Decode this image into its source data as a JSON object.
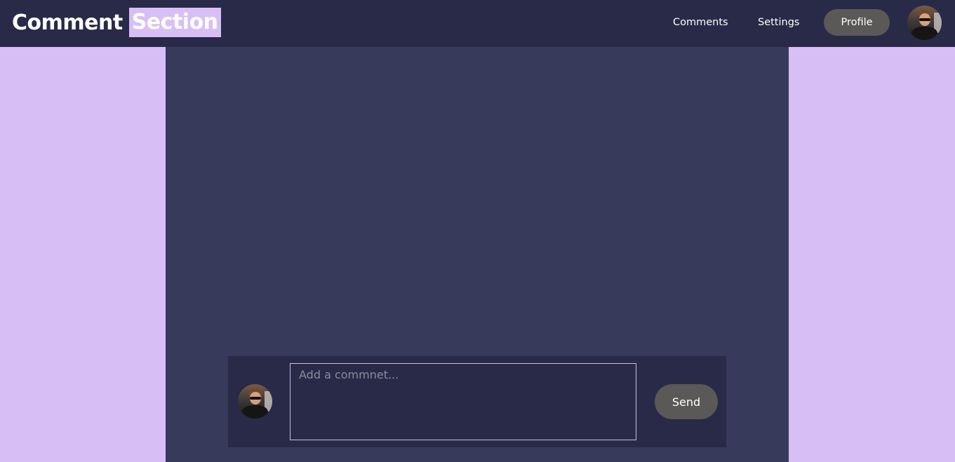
{
  "header": {
    "brand_word1": "Comment",
    "brand_word2": "Section",
    "nav_links": [
      "Comments",
      "Settings"
    ],
    "profile_label": "Profile"
  },
  "composer": {
    "placeholder": "Add a commnet...",
    "value": "",
    "send_label": "Send"
  },
  "colors": {
    "page_background": "#d7bff5",
    "navbar": "#292a47",
    "main_panel": "#383a5b",
    "button": "#5a5957",
    "brand_highlight": "#d7bff5"
  },
  "icons": {
    "nav_avatar": "user-avatar-icon",
    "composer_avatar": "user-avatar-icon"
  }
}
